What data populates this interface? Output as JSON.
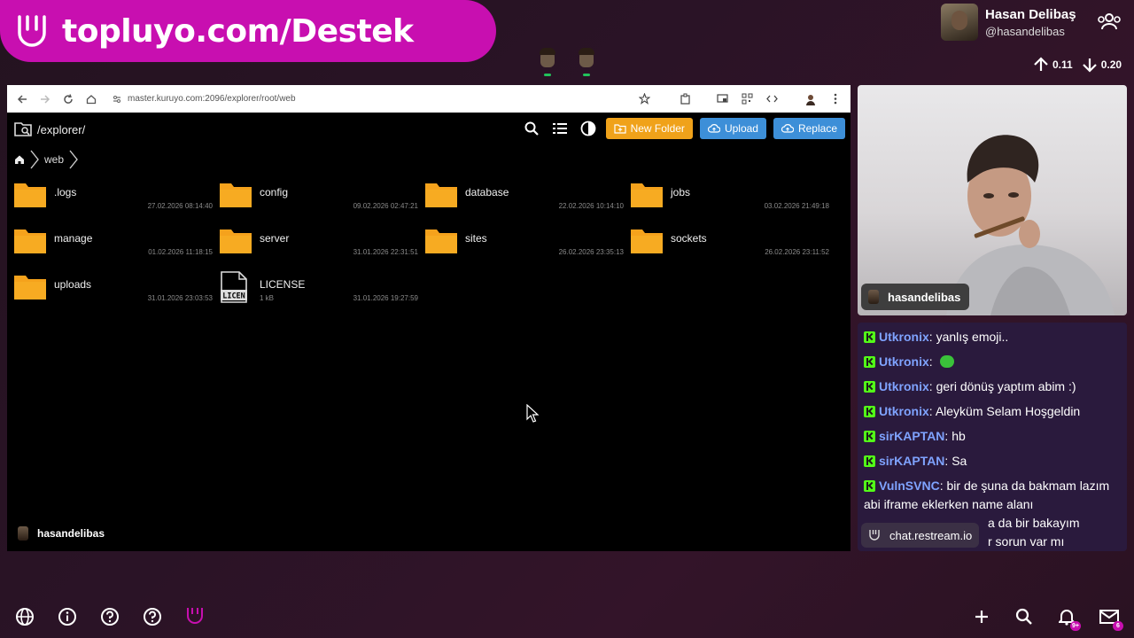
{
  "banner": {
    "text": "topluyo.com/Destek"
  },
  "profile": {
    "name": "Hasan Delibaş",
    "handle": "@hasandelibas"
  },
  "stats": {
    "upload": "0.11",
    "download": "0.20"
  },
  "browser": {
    "url": "master.kuruyo.com:2096/explorer/root/web",
    "explorer_path": "/explorer/",
    "breadcrumb": {
      "current": "web"
    },
    "buttons": {
      "new_folder": "New Folder",
      "upload": "Upload",
      "replace": "Replace"
    },
    "items": [
      {
        "name": ".logs",
        "date": "27.02.2026 08:14:40",
        "type": "folder"
      },
      {
        "name": "config",
        "date": "09.02.2026 02:47:21",
        "type": "folder"
      },
      {
        "name": "database",
        "date": "22.02.2026 10:14:10",
        "type": "folder"
      },
      {
        "name": "jobs",
        "date": "03.02.2026 21:49:18",
        "type": "folder"
      },
      {
        "name": "manage",
        "date": "01.02.2026 11:18:15",
        "type": "folder"
      },
      {
        "name": "server",
        "date": "31.01.2026 22:31:51",
        "type": "folder"
      },
      {
        "name": "sites",
        "date": "26.02.2026 23:35:13",
        "type": "folder"
      },
      {
        "name": "sockets",
        "date": "26.02.2026 23:11:52",
        "type": "folder"
      },
      {
        "name": "uploads",
        "date": "31.01.2026 23:03:53",
        "type": "folder"
      },
      {
        "name": "LICENSE",
        "date": "31.01.2026 19:27:59",
        "size": "1 kB",
        "type": "file",
        "icon_label": "LICEN"
      }
    ],
    "stream_user": "hasandelibas"
  },
  "webcam": {
    "label": "hasandelibas"
  },
  "chat": {
    "messages": [
      {
        "user": "Utkronix",
        "text": "yanlış emoji.."
      },
      {
        "user": "Utkronix",
        "text": ""
      },
      {
        "user": "Utkronix",
        "text": "geri dönüş yaptım abim :)"
      },
      {
        "user": "Utkronix",
        "text": "Aleyküm Selam Hoşgeldin"
      },
      {
        "user": "sirKAPTAN",
        "text": "hb"
      },
      {
        "user": "sirKAPTAN",
        "text": "Sa"
      },
      {
        "user": "VulnSVNC",
        "text": "bir de şuna da bakmam lazım abi iframe eklerken name alanı",
        "line3": "a da bir bakayım",
        "line4": "r sorun var mı"
      }
    ],
    "source": "chat.restream.io"
  },
  "notifications": {
    "bell_badge": "9+",
    "mail_badge": "6"
  },
  "colors": {
    "banner": "#c80fb0",
    "chat_bg": "#2a1a3d",
    "folder": "#f5a21c",
    "btn_orange": "#f0a21a",
    "btn_blue": "#3d8fd8",
    "chat_user": "#7fa3ff",
    "kick_green": "#53fc18"
  }
}
